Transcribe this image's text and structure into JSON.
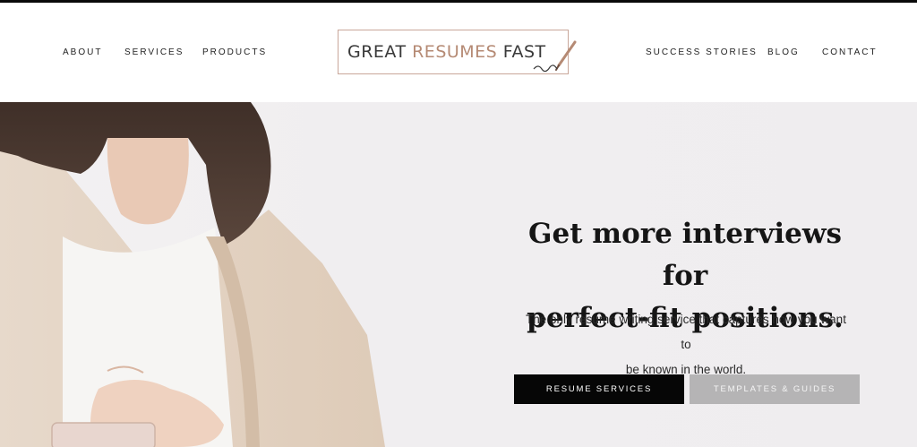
{
  "nav": {
    "left": [
      "ABOUT",
      "SERVICES",
      "PRODUCTS"
    ],
    "right": [
      "SUCCESS STORIES",
      "BLOG",
      "CONTACT"
    ]
  },
  "logo": {
    "word1": "GREAT",
    "word2": "RESUMES",
    "word3": "FAST",
    "pen_icon": "pen-nib-icon",
    "accent_color": "#b58a74"
  },
  "hero": {
    "headline_line1": "Get more interviews for",
    "headline_line2": "perfect-fit positions.",
    "subtext_line1": "The only resume writing service that captures how you want to",
    "subtext_line2": "be known in the world.",
    "primary_button": "RESUME SERVICES",
    "secondary_button": "TEMPLATES & GUIDES"
  },
  "colors": {
    "primary_button_bg": "#060606",
    "secondary_button_bg": "#b5b4b5",
    "hero_bg": "#f0eef0"
  }
}
